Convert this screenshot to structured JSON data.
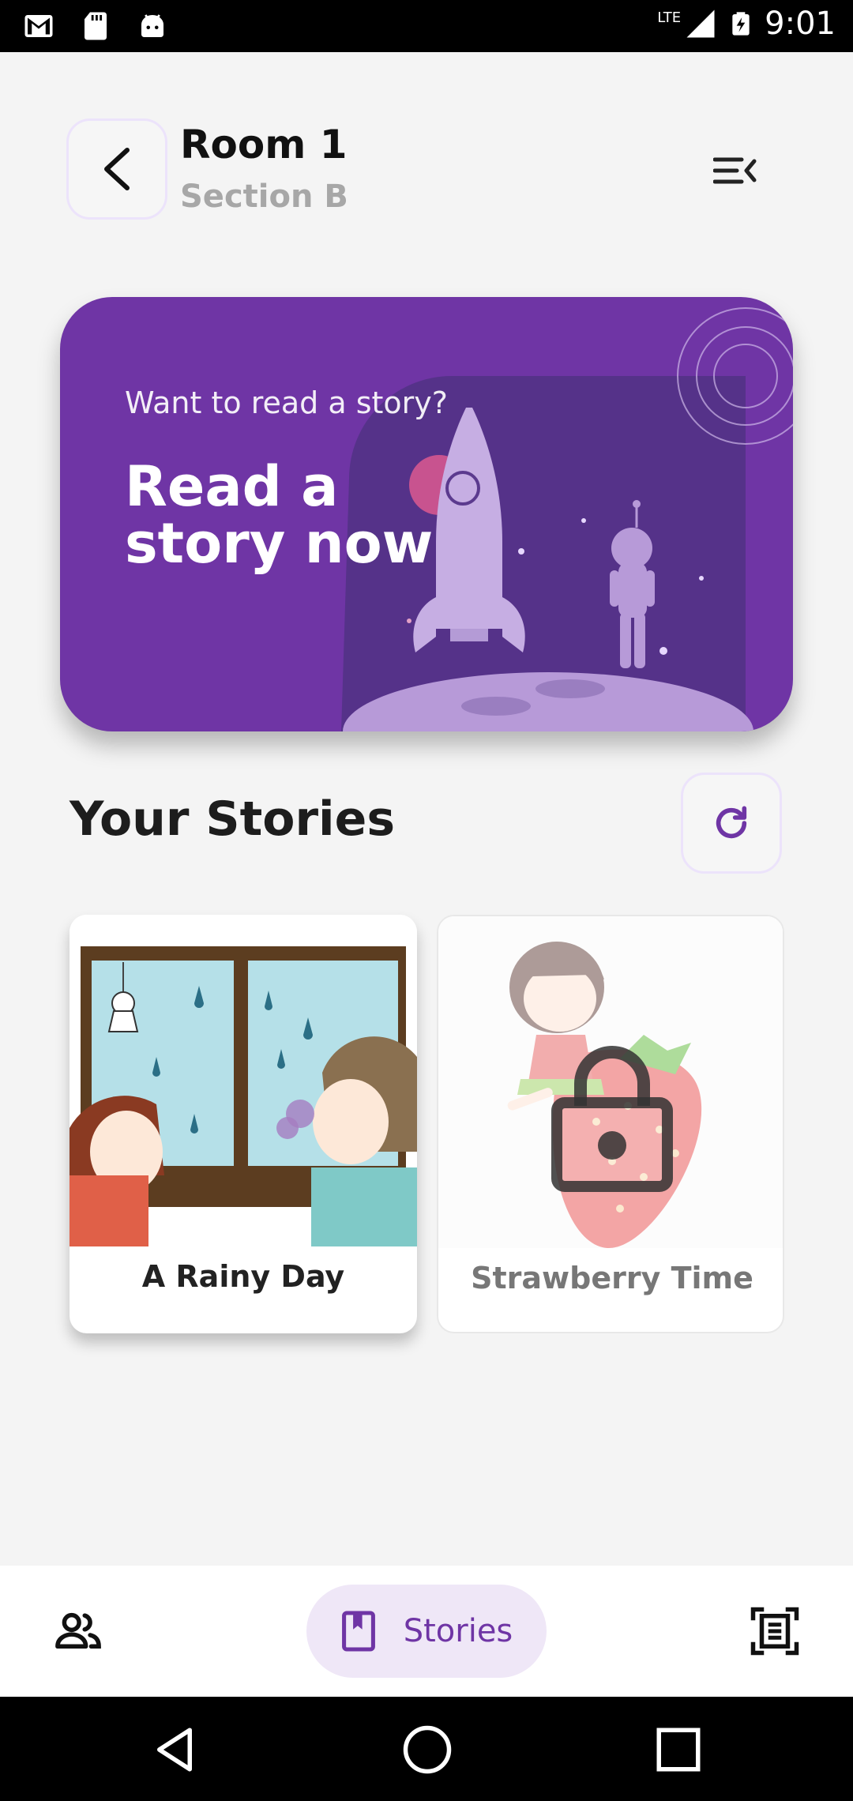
{
  "status_bar": {
    "time": "9:01",
    "network": "LTE",
    "left_icons": [
      "gmail-icon",
      "sd-card-icon",
      "android-icon"
    ],
    "right_icons": [
      "signal-icon",
      "battery-charging-icon"
    ]
  },
  "header": {
    "title": "Room 1",
    "subtitle": "Section B",
    "back_icon": "chevron-left-icon",
    "menu_icon": "menu-collapse-icon"
  },
  "banner": {
    "kicker": "Want to read a story?",
    "title": "Read a story now",
    "bg_color": "#6f35a5"
  },
  "stories_section": {
    "title": "Your Stories",
    "refresh_icon": "refresh-icon",
    "cards": [
      {
        "label": "A Rainy Day",
        "locked": false
      },
      {
        "label": "Strawberry Time",
        "locked": true
      }
    ]
  },
  "bottom_nav": {
    "items": [
      {
        "icon": "people-icon",
        "label": "",
        "active": false
      },
      {
        "icon": "book-icon",
        "label": "Stories",
        "active": true
      },
      {
        "icon": "document-scan-icon",
        "label": "",
        "active": false
      }
    ],
    "active_bg": "#efe7f7",
    "accent": "#6f35a5"
  },
  "system_nav": [
    "back-triangle-icon",
    "home-circle-icon",
    "recents-square-icon"
  ]
}
